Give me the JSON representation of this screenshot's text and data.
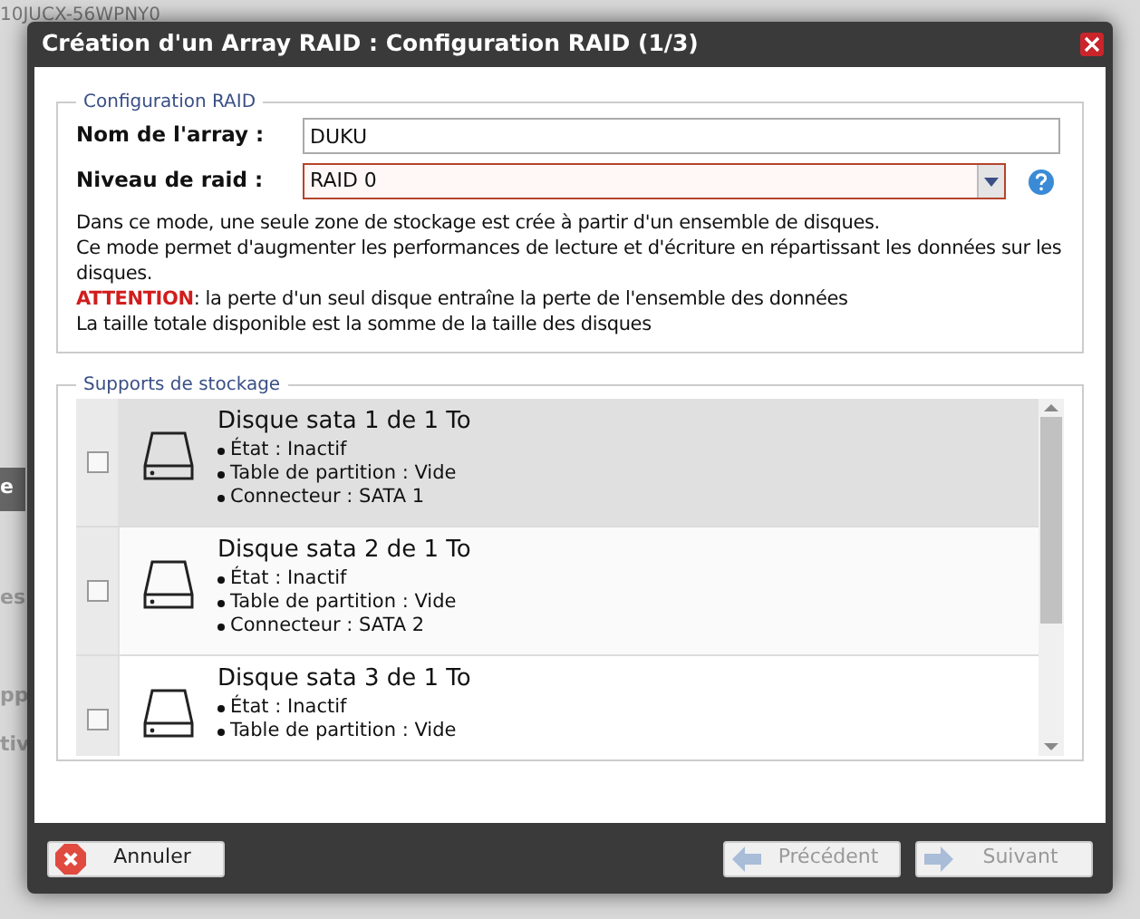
{
  "background": {
    "top_text": "10JUCX-56WPNY0",
    "side_fragments": [
      "e",
      "es",
      "pp",
      "tiv"
    ]
  },
  "window": {
    "title": "Création d'un Array RAID : Configuration RAID (1/3)"
  },
  "config": {
    "legend": "Configuration RAID",
    "fields": [
      {
        "kind": "text",
        "label": "Nom de l'array :",
        "value": "DUKU"
      },
      {
        "kind": "select",
        "label": "Niveau de raid :",
        "value": "RAID 0",
        "invalid": true
      }
    ],
    "description": [
      "Dans ce mode, une seule zone de stockage est crée à partir d'un ensemble de disques.",
      "Ce mode permet d'augmenter les performances de lecture et d'écriture en répartissant les données sur les disques."
    ],
    "warning": {
      "label": "ATTENTION",
      "text": ": la perte d'un seul disque entraîne la perte de l'ensemble des données"
    },
    "note": "La taille totale disponible est la somme de la taille des disques"
  },
  "storage": {
    "legend": "Supports de stockage",
    "disks": [
      {
        "title": "Disque sata 1 de 1 To",
        "checked": false,
        "highlighted": true,
        "details": [
          "État : Inactif",
          "Table de partition : Vide",
          "Connecteur : SATA 1"
        ]
      },
      {
        "title": "Disque sata 2 de 1 To",
        "checked": false,
        "highlighted": false,
        "details": [
          "État : Inactif",
          "Table de partition : Vide",
          "Connecteur : SATA 2"
        ]
      },
      {
        "title": "Disque sata 3 de 1 To",
        "checked": false,
        "highlighted": false,
        "details": [
          "État : Inactif",
          "Table de partition : Vide"
        ]
      }
    ]
  },
  "buttons": [
    {
      "kind": "cancel",
      "label": "Annuler",
      "disabled": false
    },
    {
      "kind": "back",
      "label": "Précédent",
      "disabled": true
    },
    {
      "kind": "next",
      "label": "Suivant",
      "disabled": true
    }
  ]
}
